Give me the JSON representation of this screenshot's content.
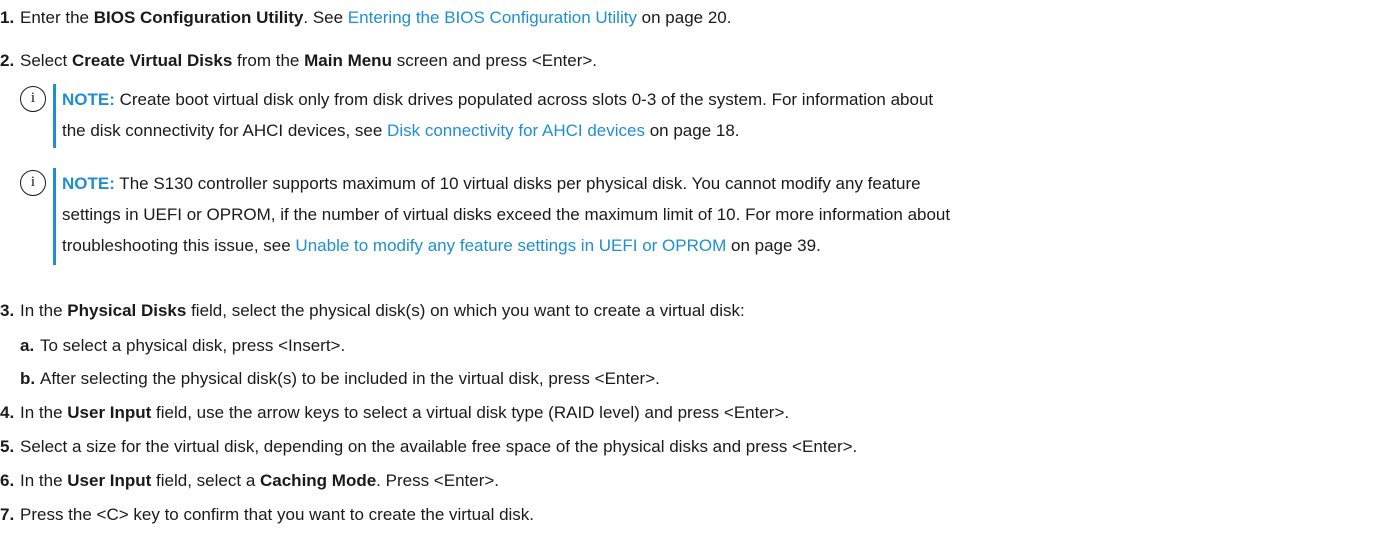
{
  "steps": [
    {
      "num": "1.",
      "parts": [
        {
          "t": "Enter the "
        },
        {
          "t": "BIOS Configuration Utility",
          "b": true
        },
        {
          "t": ". See "
        },
        {
          "t": "Entering the BIOS Configuration Utility",
          "link": true
        },
        {
          "t": " on page 20."
        }
      ]
    },
    {
      "num": "2.",
      "parts": [
        {
          "t": "Select "
        },
        {
          "t": "Create Virtual Disks",
          "b": true
        },
        {
          "t": " from the "
        },
        {
          "t": "Main Menu",
          "b": true
        },
        {
          "t": " screen and press <Enter>."
        }
      ]
    },
    {
      "num": "3.",
      "parts": [
        {
          "t": "In the "
        },
        {
          "t": "Physical Disks",
          "b": true
        },
        {
          "t": " field, select the physical disk(s) on which you want to create a virtual disk:"
        }
      ]
    },
    {
      "num": "4.",
      "parts": [
        {
          "t": "In the "
        },
        {
          "t": "User Input",
          "b": true
        },
        {
          "t": " field, use the arrow keys to select a virtual disk type (RAID level) and press <Enter>."
        }
      ]
    },
    {
      "num": "5.",
      "parts": [
        {
          "t": "Select a size for the virtual disk, depending on the available free space of the physical disks and press <Enter>."
        }
      ]
    },
    {
      "num": "6.",
      "parts": [
        {
          "t": "In the "
        },
        {
          "t": "User Input",
          "b": true
        },
        {
          "t": " field, select a "
        },
        {
          "t": "Caching Mode",
          "b": true
        },
        {
          "t": ". Press <Enter>."
        }
      ]
    },
    {
      "num": "7.",
      "parts": [
        {
          "t": "Press the <C> key to confirm that you want to create the virtual disk."
        }
      ]
    }
  ],
  "substeps": [
    {
      "num": "a.",
      "text": "To select a physical disk, press <Insert>."
    },
    {
      "num": "b.",
      "text": "After selecting the physical disk(s) to be included in the virtual disk, press <Enter>."
    }
  ],
  "notes": [
    {
      "icon": "i",
      "label": "NOTE:",
      "lines": [
        [
          {
            "t": " Create boot virtual disk only from disk drives populated across slots 0-3 of the system. For information about"
          }
        ],
        [
          {
            "t": "the disk connectivity for AHCI devices, see "
          },
          {
            "t": "Disk connectivity for AHCI devices",
            "link": true
          },
          {
            "t": " on page 18."
          }
        ]
      ]
    },
    {
      "icon": "i",
      "label": "NOTE:",
      "lines": [
        [
          {
            "t": " The S130 controller supports maximum of 10 virtual disks per physical disk. You cannot modify any feature"
          }
        ],
        [
          {
            "t": "settings in UEFI or OPROM, if the number of virtual disks exceed the maximum limit of 10. For more information about"
          }
        ],
        [
          {
            "t": "troubleshooting this issue, see "
          },
          {
            "t": "Unable to modify any feature settings in UEFI or OPROM",
            "link": true
          },
          {
            "t": " on page 39."
          }
        ]
      ]
    }
  ],
  "colors": {
    "link": "#1f8fd1",
    "note_bar": "#1f8fd1",
    "text": "#1a1a1a"
  }
}
